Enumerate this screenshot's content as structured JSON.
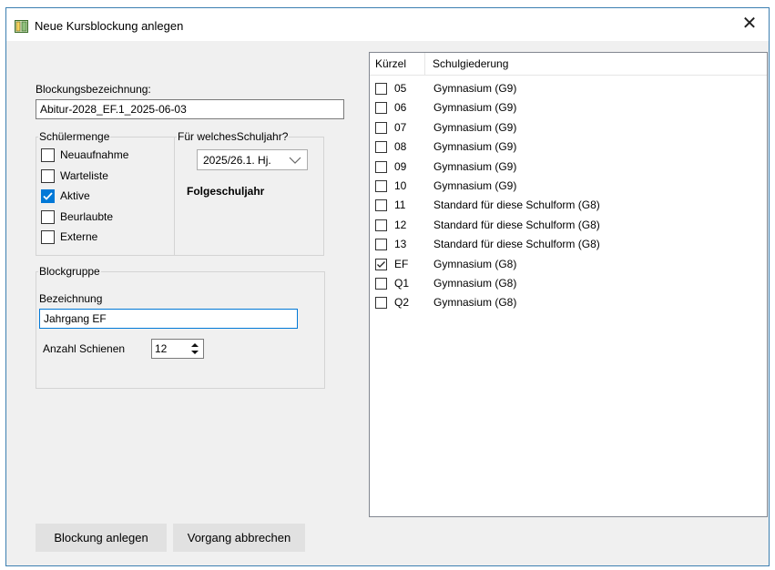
{
  "window": {
    "title": "Neue Kursblockung anlegen",
    "close_label": "✕"
  },
  "form": {
    "name_label": "Blockungsbezeichnung:",
    "name_value": "Abitur-2028_EF.1_2025-06-03",
    "students_group": {
      "legend": "Schülermenge",
      "options": [
        {
          "label": "Neuaufnahme",
          "checked": false
        },
        {
          "label": "Warteliste",
          "checked": false
        },
        {
          "label": "Aktive",
          "checked": true
        },
        {
          "label": "Beurlaubte",
          "checked": false
        },
        {
          "label": "Externe",
          "checked": false
        }
      ]
    },
    "year_group": {
      "legend": "Für welchesSchuljahr?",
      "selected": "2025/26.1. Hj.",
      "note": "Folgeschuljahr"
    },
    "block_group": {
      "legend": "Blockgruppe",
      "name_label": "Bezeichnung",
      "name_value": "Jahrgang EF",
      "rails_label": "Anzahl Schienen",
      "rails_value": "12"
    }
  },
  "list": {
    "headers": {
      "short": "Kürzel",
      "structure": "Schulgiederung"
    },
    "rows": [
      {
        "short": "05",
        "structure": "Gymnasium (G9)",
        "checked": false
      },
      {
        "short": "06",
        "structure": "Gymnasium (G9)",
        "checked": false
      },
      {
        "short": "07",
        "structure": "Gymnasium (G9)",
        "checked": false
      },
      {
        "short": "08",
        "structure": "Gymnasium (G9)",
        "checked": false
      },
      {
        "short": "09",
        "structure": "Gymnasium (G9)",
        "checked": false
      },
      {
        "short": "10",
        "structure": "Gymnasium (G9)",
        "checked": false
      },
      {
        "short": "11",
        "structure": "Standard für diese Schulform (G8)",
        "checked": false
      },
      {
        "short": "12",
        "structure": "Standard für diese Schulform (G8)",
        "checked": false
      },
      {
        "short": "13",
        "structure": "Standard für diese Schulform (G8)",
        "checked": false
      },
      {
        "short": "EF",
        "structure": "Gymnasium (G8)",
        "checked": true
      },
      {
        "short": "Q1",
        "structure": "Gymnasium (G8)",
        "checked": false
      },
      {
        "short": "Q2",
        "structure": "Gymnasium (G8)",
        "checked": false
      }
    ]
  },
  "buttons": {
    "create": "Blockung anlegen",
    "cancel": "Vorgang abbrechen"
  },
  "icons": {
    "app": "app-window-icon",
    "close": "close-icon",
    "dropdown": "chevron-down-icon",
    "spinner": "spinner-arrows-icon"
  },
  "colors": {
    "accent": "#0078d7",
    "window_border": "#3c7fb1",
    "client_bg": "#f0f0f0",
    "button_bg": "#e1e1e1"
  }
}
